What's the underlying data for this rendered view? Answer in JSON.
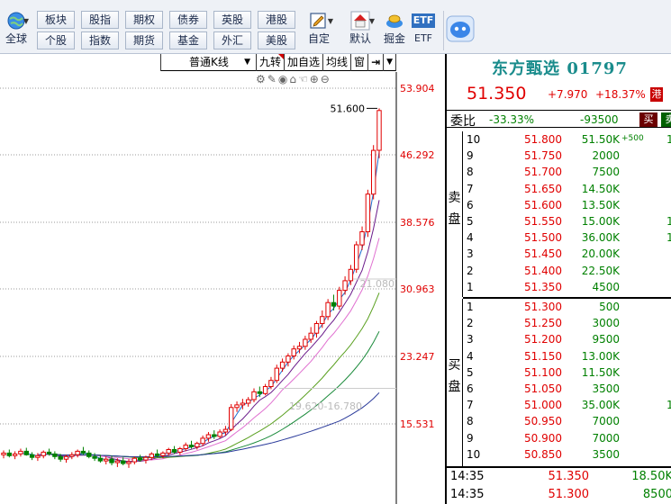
{
  "toolbar": {
    "globe_label": "全球",
    "market_buttons": [
      {
        "label": "板块"
      },
      {
        "label": "股指"
      },
      {
        "label": "期权"
      },
      {
        "label": "债券"
      },
      {
        "label": "英股"
      },
      {
        "label": "港股"
      },
      {
        "label": "个股"
      },
      {
        "label": "指数"
      },
      {
        "label": "期货"
      },
      {
        "label": "基金"
      },
      {
        "label": "外汇"
      },
      {
        "label": "美股"
      }
    ],
    "custom_label": "自定",
    "default_label": "默认",
    "dig_label": "掘金",
    "etf_icon_text": "ETF",
    "etf_label": "ETF"
  },
  "kline_header": {
    "period": "普通K线",
    "nine": "九转",
    "add_watch": "加自选",
    "ma_line": "均线",
    "window": "窗"
  },
  "chart_data": {
    "type": "candlestick",
    "y_ticks": [
      53.904,
      46.292,
      38.576,
      30.963,
      23.247,
      15.531
    ],
    "ylim": [
      9.0,
      56.0
    ],
    "max_label": "51.600",
    "range_labels": [
      "21.080",
      "19.620-16.780"
    ],
    "candles": [
      {
        "o": 12.0,
        "h": 12.5,
        "l": 11.6,
        "c": 12.2
      },
      {
        "o": 12.2,
        "h": 12.6,
        "l": 11.7,
        "c": 11.9
      },
      {
        "o": 11.9,
        "h": 12.4,
        "l": 11.5,
        "c": 12.1
      },
      {
        "o": 12.1,
        "h": 12.7,
        "l": 11.8,
        "c": 12.4
      },
      {
        "o": 12.4,
        "h": 12.8,
        "l": 11.9,
        "c": 12.0
      },
      {
        "o": 12.0,
        "h": 12.3,
        "l": 11.4,
        "c": 11.7
      },
      {
        "o": 11.7,
        "h": 12.2,
        "l": 11.3,
        "c": 11.9
      },
      {
        "o": 11.9,
        "h": 12.5,
        "l": 11.6,
        "c": 12.3
      },
      {
        "o": 12.3,
        "h": 12.7,
        "l": 11.9,
        "c": 12.1
      },
      {
        "o": 12.1,
        "h": 12.4,
        "l": 11.5,
        "c": 11.8
      },
      {
        "o": 11.8,
        "h": 12.1,
        "l": 11.2,
        "c": 11.5
      },
      {
        "o": 11.5,
        "h": 12.0,
        "l": 11.1,
        "c": 11.8
      },
      {
        "o": 11.8,
        "h": 12.3,
        "l": 11.5,
        "c": 12.0
      },
      {
        "o": 12.0,
        "h": 12.6,
        "l": 11.7,
        "c": 12.4
      },
      {
        "o": 12.4,
        "h": 12.9,
        "l": 12.0,
        "c": 12.2
      },
      {
        "o": 12.2,
        "h": 12.5,
        "l": 11.6,
        "c": 11.8
      },
      {
        "o": 11.8,
        "h": 12.2,
        "l": 11.3,
        "c": 11.6
      },
      {
        "o": 11.6,
        "h": 12.0,
        "l": 11.1,
        "c": 11.3
      },
      {
        "o": 11.3,
        "h": 11.8,
        "l": 10.9,
        "c": 11.5
      },
      {
        "o": 11.5,
        "h": 11.9,
        "l": 10.8,
        "c": 11.1
      },
      {
        "o": 11.1,
        "h": 11.6,
        "l": 10.6,
        "c": 11.3
      },
      {
        "o": 11.3,
        "h": 11.7,
        "l": 10.8,
        "c": 11.0
      },
      {
        "o": 11.0,
        "h": 11.5,
        "l": 10.5,
        "c": 11.2
      },
      {
        "o": 11.2,
        "h": 11.8,
        "l": 10.9,
        "c": 11.6
      },
      {
        "o": 11.6,
        "h": 12.0,
        "l": 11.2,
        "c": 11.4
      },
      {
        "o": 11.4,
        "h": 11.9,
        "l": 11.0,
        "c": 11.7
      },
      {
        "o": 11.7,
        "h": 12.3,
        "l": 11.4,
        "c": 12.1
      },
      {
        "o": 12.1,
        "h": 12.6,
        "l": 11.7,
        "c": 11.9
      },
      {
        "o": 11.9,
        "h": 12.4,
        "l": 11.6,
        "c": 12.2
      },
      {
        "o": 12.2,
        "h": 12.8,
        "l": 11.9,
        "c": 12.6
      },
      {
        "o": 12.6,
        "h": 13.0,
        "l": 12.1,
        "c": 12.3
      },
      {
        "o": 12.3,
        "h": 12.9,
        "l": 12.0,
        "c": 12.7
      },
      {
        "o": 12.7,
        "h": 13.4,
        "l": 12.4,
        "c": 13.1
      },
      {
        "o": 13.1,
        "h": 13.6,
        "l": 12.7,
        "c": 12.9
      },
      {
        "o": 12.9,
        "h": 13.5,
        "l": 12.6,
        "c": 13.3
      },
      {
        "o": 13.3,
        "h": 14.2,
        "l": 13.0,
        "c": 13.9
      },
      {
        "o": 13.9,
        "h": 14.6,
        "l": 13.5,
        "c": 14.3
      },
      {
        "o": 14.3,
        "h": 14.8,
        "l": 13.8,
        "c": 14.1
      },
      {
        "o": 14.1,
        "h": 14.9,
        "l": 13.9,
        "c": 14.6
      },
      {
        "o": 14.6,
        "h": 15.3,
        "l": 14.2,
        "c": 14.9
      },
      {
        "o": 14.9,
        "h": 17.8,
        "l": 14.7,
        "c": 17.4
      },
      {
        "o": 17.4,
        "h": 18.1,
        "l": 16.9,
        "c": 17.7
      },
      {
        "o": 17.7,
        "h": 18.4,
        "l": 17.2,
        "c": 17.9
      },
      {
        "o": 17.9,
        "h": 18.6,
        "l": 17.5,
        "c": 18.3
      },
      {
        "o": 18.3,
        "h": 19.6,
        "l": 18.0,
        "c": 19.2
      },
      {
        "o": 19.2,
        "h": 19.8,
        "l": 18.6,
        "c": 19.0
      },
      {
        "o": 19.0,
        "h": 20.1,
        "l": 18.8,
        "c": 19.8
      },
      {
        "o": 19.8,
        "h": 20.9,
        "l": 19.5,
        "c": 20.5
      },
      {
        "o": 20.5,
        "h": 22.3,
        "l": 20.2,
        "c": 21.9
      },
      {
        "o": 21.9,
        "h": 23.0,
        "l": 21.5,
        "c": 22.6
      },
      {
        "o": 22.6,
        "h": 23.6,
        "l": 22.1,
        "c": 23.3
      },
      {
        "o": 23.3,
        "h": 24.5,
        "l": 22.9,
        "c": 24.1
      },
      {
        "o": 24.1,
        "h": 24.9,
        "l": 23.6,
        "c": 24.4
      },
      {
        "o": 24.4,
        "h": 25.6,
        "l": 24.0,
        "c": 25.2
      },
      {
        "o": 25.2,
        "h": 26.6,
        "l": 24.8,
        "c": 25.9
      },
      {
        "o": 25.9,
        "h": 27.3,
        "l": 25.4,
        "c": 27.0
      },
      {
        "o": 27.0,
        "h": 28.5,
        "l": 26.5,
        "c": 27.8
      },
      {
        "o": 27.8,
        "h": 29.8,
        "l": 27.4,
        "c": 29.4
      },
      {
        "o": 29.4,
        "h": 30.3,
        "l": 28.5,
        "c": 29.0
      },
      {
        "o": 29.0,
        "h": 31.2,
        "l": 28.6,
        "c": 30.8
      },
      {
        "o": 30.8,
        "h": 32.4,
        "l": 30.3,
        "c": 31.9
      },
      {
        "o": 31.9,
        "h": 33.7,
        "l": 31.4,
        "c": 33.2
      },
      {
        "o": 33.2,
        "h": 36.4,
        "l": 32.8,
        "c": 36.0
      },
      {
        "o": 36.0,
        "h": 38.1,
        "l": 35.4,
        "c": 37.5
      },
      {
        "o": 37.5,
        "h": 42.3,
        "l": 36.9,
        "c": 41.8
      },
      {
        "o": 41.8,
        "h": 47.4,
        "l": 41.2,
        "c": 46.8
      },
      {
        "o": 46.8,
        "h": 51.6,
        "l": 45.9,
        "c": 51.35
      }
    ]
  },
  "quote": {
    "name": "东方甄选 01797",
    "price": "51.350",
    "change": "+7.970",
    "pct": "+18.37%",
    "tag": "港",
    "wb_label": "委比",
    "wb_pct": "-33.33%",
    "wb_diff": "-93500",
    "sell_tag": "买",
    "buy_tag": "卖",
    "ask_side": "卖盘",
    "bid_side": "买盘",
    "asks": [
      {
        "n": "10",
        "p": "51.800",
        "v": "51.50K",
        "x": "+500",
        "e": "1"
      },
      {
        "n": "9",
        "p": "51.750",
        "v": "2000",
        "x": "",
        "e": ""
      },
      {
        "n": "8",
        "p": "51.700",
        "v": "7500",
        "x": "",
        "e": ""
      },
      {
        "n": "7",
        "p": "51.650",
        "v": "14.50K",
        "x": "",
        "e": ""
      },
      {
        "n": "6",
        "p": "51.600",
        "v": "13.50K",
        "x": "",
        "e": ""
      },
      {
        "n": "5",
        "p": "51.550",
        "v": "15.00K",
        "x": "",
        "e": "1"
      },
      {
        "n": "4",
        "p": "51.500",
        "v": "36.00K",
        "x": "",
        "e": "1"
      },
      {
        "n": "3",
        "p": "51.450",
        "v": "20.00K",
        "x": "",
        "e": ""
      },
      {
        "n": "2",
        "p": "51.400",
        "v": "22.50K",
        "x": "",
        "e": ""
      },
      {
        "n": "1",
        "p": "51.350",
        "v": "4500",
        "x": "",
        "e": ""
      }
    ],
    "bids": [
      {
        "n": "1",
        "p": "51.300",
        "v": "500",
        "e": ""
      },
      {
        "n": "2",
        "p": "51.250",
        "v": "3000",
        "e": ""
      },
      {
        "n": "3",
        "p": "51.200",
        "v": "9500",
        "e": ""
      },
      {
        "n": "4",
        "p": "51.150",
        "v": "13.00K",
        "e": ""
      },
      {
        "n": "5",
        "p": "51.100",
        "v": "11.50K",
        "e": ""
      },
      {
        "n": "6",
        "p": "51.050",
        "v": "3500",
        "e": ""
      },
      {
        "n": "7",
        "p": "51.000",
        "v": "35.00K",
        "e": "1"
      },
      {
        "n": "8",
        "p": "50.950",
        "v": "7000",
        "e": ""
      },
      {
        "n": "9",
        "p": "50.900",
        "v": "7000",
        "e": ""
      },
      {
        "n": "10",
        "p": "50.850",
        "v": "3500",
        "e": ""
      }
    ],
    "trades": [
      {
        "t": "14:35",
        "p": "51.350",
        "v": "18.50K"
      },
      {
        "t": "14:35",
        "p": "51.300",
        "v": "8500"
      }
    ]
  },
  "colors": {
    "up": "#e00000",
    "down": "#008000",
    "name": "#1a8c8c",
    "ma": [
      "#1f6fd0",
      "#6a1a8a",
      "#e070d0",
      "#5aa020",
      "#1a8a3a",
      "#2a3a9a"
    ]
  }
}
